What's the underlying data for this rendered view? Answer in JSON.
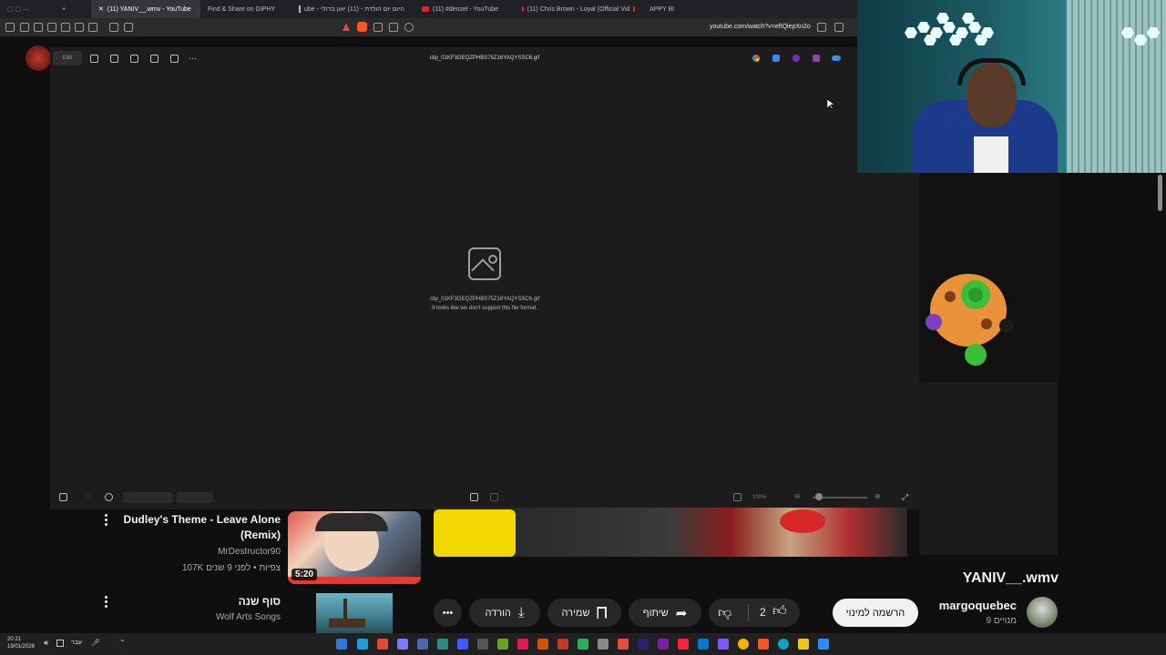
{
  "browser": {
    "tabs": [
      {
        "label": "(11) YANIV__.wmv - YouTube",
        "active": true
      },
      {
        "label": "Find & Share on GIPHY",
        "active": false
      },
      {
        "label": "ube - היום יום הולדת - (11) יאון ברזלי",
        "active": false
      },
      {
        "label": "(11) #denzel - YouTube",
        "active": false
      },
      {
        "label": "(11) Chris Brown - Loyal (Official Vid",
        "active": false
      },
      {
        "label": "APPY BI",
        "active": false
      }
    ],
    "url": "youtube.com/watch?v=eftQlepXn2o"
  },
  "viewer": {
    "edit_label": "Edit",
    "file_title": "clip_01KF3GEQZPHBS75Z16YAQYSSC6.gif",
    "unsupported_file": "clip_01KF3GEQZPHBS75Z16YAQYSSC6.gif",
    "unsupported_message": "It looks like we don't support this file format.",
    "zoom": "100%"
  },
  "video": {
    "title": "YANIV__.wmv",
    "channel": "margoquebec",
    "subscribers": "9 מנויים",
    "subscribe_label": "הרשמה למינוי",
    "likes": "2",
    "share_label": "שיתוף",
    "save_label": "שמירה",
    "download_label": "הורדה"
  },
  "recommended": [
    {
      "title_line1": "Dudley's Theme - Leave Alone",
      "title_line2": "(Remix)",
      "channel": "MrDestructor90",
      "meta": "107K צפיות • לפני 9 שנים",
      "duration": "5:20"
    },
    {
      "title": "סוף שנה",
      "channel": "Wolf Arts Songs"
    }
  ],
  "taskbar": {
    "time": "20:21",
    "date": "19/01/2026",
    "language": "עבר"
  }
}
